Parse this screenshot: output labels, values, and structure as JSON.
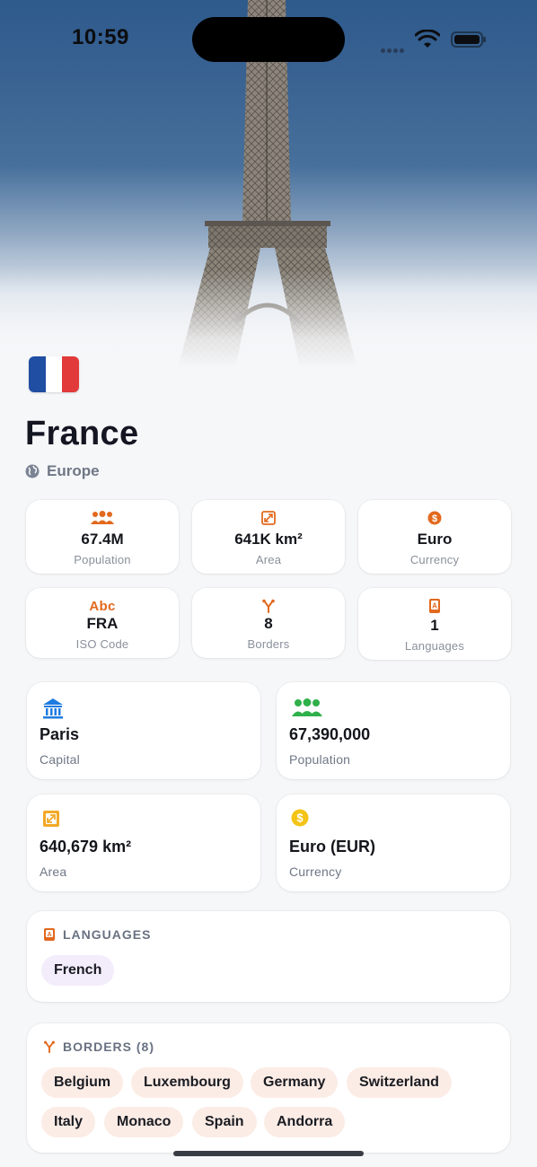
{
  "status_bar": {
    "time": "10:59"
  },
  "country": {
    "name": "France",
    "region": "Europe",
    "flag_colors": [
      "#1f4ea3",
      "#ffffff",
      "#e23a3a"
    ]
  },
  "quick_stats": [
    {
      "icon": "people-icon",
      "value": "67.4M",
      "label": "Population"
    },
    {
      "icon": "area-icon",
      "value": "641K km²",
      "label": "Area"
    },
    {
      "icon": "dollar-icon",
      "value": "Euro",
      "label": "Currency"
    },
    {
      "icon": "abc-icon",
      "icon_text": "Abc",
      "value": "FRA",
      "label": "ISO Code"
    },
    {
      "icon": "fork-icon",
      "value": "8",
      "label": "Borders"
    },
    {
      "icon": "book-icon",
      "value": "1",
      "label": "Languages"
    }
  ],
  "detail_cards": [
    {
      "icon": "bank-icon",
      "value": "Paris",
      "label": "Capital"
    },
    {
      "icon": "people-icon",
      "value": "67,390,000",
      "label": "Population"
    },
    {
      "icon": "area-icon",
      "value": "640,679 km²",
      "label": "Area"
    },
    {
      "icon": "coin-icon",
      "value": "Euro (EUR)",
      "label": "Currency"
    }
  ],
  "languages": {
    "title": "LANGUAGES",
    "items": [
      "French"
    ]
  },
  "borders": {
    "title": "BORDERS (8)",
    "items": [
      "Belgium",
      "Luxembourg",
      "Germany",
      "Switzerland",
      "Italy",
      "Monaco",
      "Spain",
      "Andorra"
    ]
  },
  "colors": {
    "accent_orange": "#e2691e",
    "blue": "#1e7be0",
    "green": "#2fb04a",
    "gold": "#f3c415"
  }
}
